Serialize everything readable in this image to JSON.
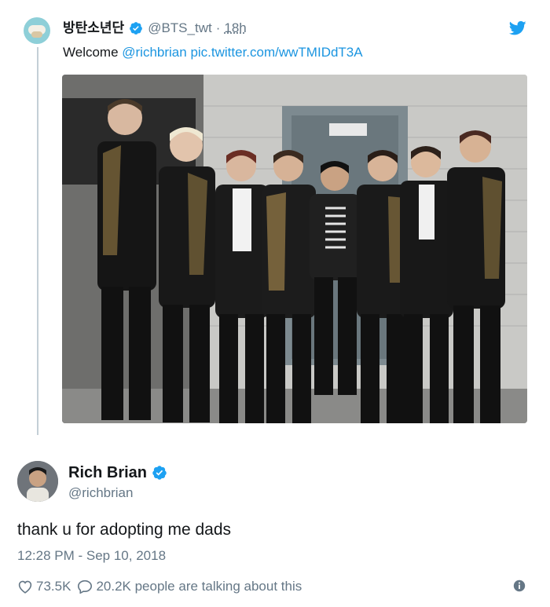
{
  "quoted_tweet": {
    "display_name": "방탄소년단",
    "handle": "@BTS_twt",
    "separator": "·",
    "time": "18h",
    "text_prefix": "Welcome ",
    "mention": "@richbrian",
    "link": "pic.twitter.com/wwTMIDdT3A"
  },
  "reply_tweet": {
    "display_name": "Rich Brian",
    "handle": "@richbrian",
    "text": "thank u for adopting me dads",
    "timestamp": "12:28 PM - Sep 10, 2018",
    "likes": "73.5K",
    "comments": "20.2K people are talking about this"
  },
  "colors": {
    "link": "#1b95e0",
    "verified": "#1da1f2",
    "muted": "#657786"
  },
  "icons": [
    "twitter-bird-icon",
    "verified-icon",
    "heart-icon",
    "comment-icon",
    "info-icon"
  ]
}
